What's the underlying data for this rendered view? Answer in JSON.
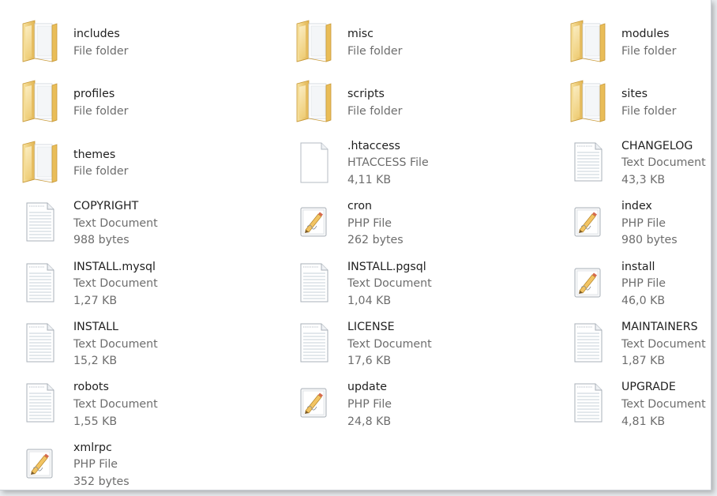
{
  "window": {
    "title": ""
  },
  "items": [
    {
      "name": "includes",
      "type": "File folder",
      "size": "",
      "icon": "folder-icon"
    },
    {
      "name": "misc",
      "type": "File folder",
      "size": "",
      "icon": "folder-icon"
    },
    {
      "name": "modules",
      "type": "File folder",
      "size": "",
      "icon": "folder-icon"
    },
    {
      "name": "profiles",
      "type": "File folder",
      "size": "",
      "icon": "folder-icon"
    },
    {
      "name": "scripts",
      "type": "File folder",
      "size": "",
      "icon": "folder-icon"
    },
    {
      "name": "sites",
      "type": "File folder",
      "size": "",
      "icon": "folder-icon"
    },
    {
      "name": "themes",
      "type": "File folder",
      "size": "",
      "icon": "folder-icon"
    },
    {
      "name": ".htaccess",
      "type": "HTACCESS File",
      "size": "4,11 KB",
      "icon": "blank-file-icon"
    },
    {
      "name": "CHANGELOG",
      "type": "Text Document",
      "size": "43,3 KB",
      "icon": "text-document-icon"
    },
    {
      "name": "COPYRIGHT",
      "type": "Text Document",
      "size": "988 bytes",
      "icon": "text-document-icon"
    },
    {
      "name": "cron",
      "type": "PHP File",
      "size": "262 bytes",
      "icon": "php-file-icon"
    },
    {
      "name": "index",
      "type": "PHP File",
      "size": "980 bytes",
      "icon": "php-file-icon"
    },
    {
      "name": "INSTALL.mysql",
      "type": "Text Document",
      "size": "1,27 KB",
      "icon": "text-document-icon"
    },
    {
      "name": "INSTALL.pgsql",
      "type": "Text Document",
      "size": "1,04 KB",
      "icon": "text-document-icon"
    },
    {
      "name": "install",
      "type": "PHP File",
      "size": "46,0 KB",
      "icon": "php-file-icon"
    },
    {
      "name": "INSTALL",
      "type": "Text Document",
      "size": "15,2 KB",
      "icon": "text-document-icon"
    },
    {
      "name": "LICENSE",
      "type": "Text Document",
      "size": "17,6 KB",
      "icon": "text-document-icon"
    },
    {
      "name": "MAINTAINERS",
      "type": "Text Document",
      "size": "1,87 KB",
      "icon": "text-document-icon"
    },
    {
      "name": "robots",
      "type": "Text Document",
      "size": "1,55 KB",
      "icon": "text-document-icon"
    },
    {
      "name": "update",
      "type": "PHP File",
      "size": "24,8 KB",
      "icon": "php-file-icon"
    },
    {
      "name": "UPGRADE",
      "type": "Text Document",
      "size": "4,81 KB",
      "icon": "text-document-icon"
    },
    {
      "name": "xmlrpc",
      "type": "PHP File",
      "size": "352 bytes",
      "icon": "php-file-icon"
    }
  ],
  "colors": {
    "folder_front": "#f4d98a",
    "folder_back": "#e7c065",
    "paper": "#ffffff",
    "paper_border": "#a9b0b8",
    "text_lines": "#c7d0da"
  }
}
